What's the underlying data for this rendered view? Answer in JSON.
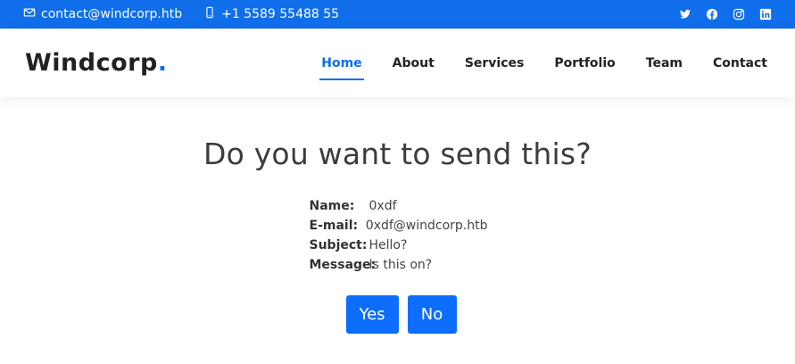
{
  "topbar": {
    "email": "contact@windcorp.htb",
    "phone": "+1 5589 55488 55",
    "social_icons": [
      "twitter-icon",
      "facebook-icon",
      "instagram-icon",
      "linkedin-icon"
    ]
  },
  "header": {
    "logo_text": "Windcorp",
    "logo_dot": ".",
    "nav": {
      "home": "Home",
      "about": "About",
      "services": "Services",
      "portfolio": "Portfolio",
      "team": "Team",
      "contact": "Contact"
    }
  },
  "main": {
    "title": "Do you want to send this?",
    "fields": {
      "name_label": "Name:",
      "name_value": "0xdf",
      "email_label": "E-mail:",
      "email_value": "0xdf@windcorp.htb",
      "subject_label": "Subject:",
      "subject_value": "Hello?",
      "message_label": "Message:",
      "message_value": "Is this on?"
    },
    "yes_label": "Yes",
    "no_label": "No"
  },
  "colors": {
    "accent": "#106eea",
    "button": "#0d6efd"
  }
}
